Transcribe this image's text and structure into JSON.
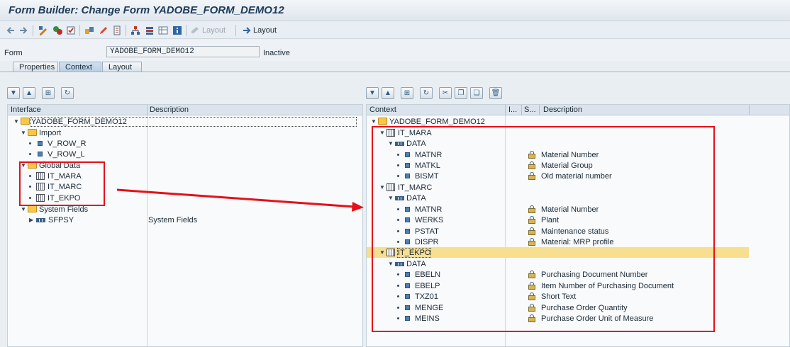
{
  "window": {
    "title": "Form Builder: Change Form YADOBE_FORM_DEMO12"
  },
  "toolbar": {
    "layout_disabled_label": "Layout",
    "layout_label": "Layout"
  },
  "form": {
    "label": "Form",
    "value": "YADOBE_FORM_DEMO12",
    "status": "Inactive"
  },
  "tabs": [
    {
      "label": "Properties"
    },
    {
      "label": "Context"
    },
    {
      "label": "Layout"
    }
  ],
  "interface_pane": {
    "col_interface": "Interface",
    "col_description": "Description",
    "rows": [
      {
        "label": "YADOBE_FORM_DEMO12",
        "desc": ""
      },
      {
        "label": "Import",
        "desc": ""
      },
      {
        "label": "V_ROW_R",
        "desc": ""
      },
      {
        "label": "V_ROW_L",
        "desc": ""
      },
      {
        "label": "Global Data",
        "desc": ""
      },
      {
        "label": "IT_MARA",
        "desc": ""
      },
      {
        "label": "IT_MARC",
        "desc": ""
      },
      {
        "label": "IT_EKPO",
        "desc": ""
      },
      {
        "label": "System Fields",
        "desc": ""
      },
      {
        "label": "SFPSY",
        "desc": "System Fields"
      }
    ]
  },
  "context_pane": {
    "col_context": "Context",
    "col_i": "I...",
    "col_s": "S...",
    "col_description": "Description",
    "rows": [
      {
        "label": "YADOBE_FORM_DEMO12",
        "desc": ""
      },
      {
        "label": "IT_MARA",
        "desc": ""
      },
      {
        "label": "DATA",
        "desc": ""
      },
      {
        "label": "MATNR",
        "desc": "Material Number"
      },
      {
        "label": "MATKL",
        "desc": "Material Group"
      },
      {
        "label": "BISMT",
        "desc": "Old material number"
      },
      {
        "label": "IT_MARC",
        "desc": ""
      },
      {
        "label": "DATA",
        "desc": ""
      },
      {
        "label": "MATNR",
        "desc": "Material Number"
      },
      {
        "label": "WERKS",
        "desc": "Plant"
      },
      {
        "label": "PSTAT",
        "desc": "Maintenance status"
      },
      {
        "label": "DISPR",
        "desc": "Material: MRP profile"
      },
      {
        "label": "IT_EKPO",
        "desc": ""
      },
      {
        "label": "DATA",
        "desc": ""
      },
      {
        "label": "EBELN",
        "desc": "Purchasing Document Number"
      },
      {
        "label": "EBELP",
        "desc": "Item Number of Purchasing Document"
      },
      {
        "label": "TXZ01",
        "desc": "Short Text"
      },
      {
        "label": "MENGE",
        "desc": "Purchase Order Quantity"
      },
      {
        "label": "MEINS",
        "desc": "Purchase Order Unit of Measure"
      }
    ]
  },
  "colors": {
    "annotation": "#e5101a",
    "selection": "#f7df8f"
  }
}
